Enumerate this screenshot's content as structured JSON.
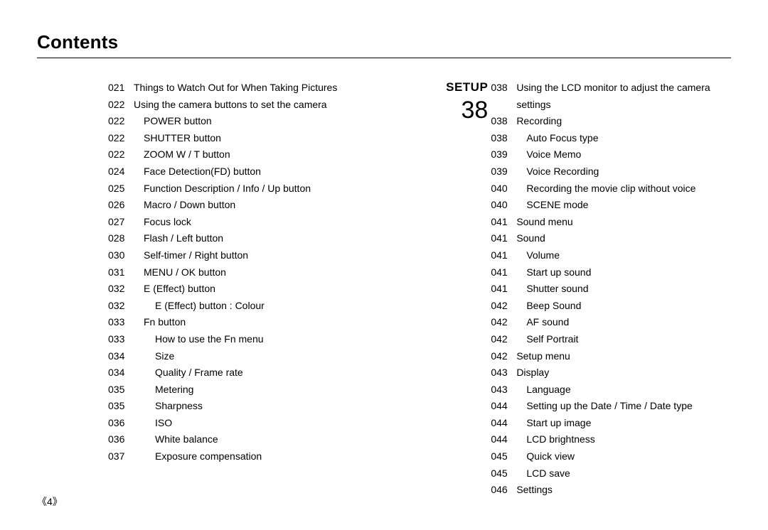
{
  "title": "Contents",
  "page_number": "4",
  "left_column": [
    {
      "page": "021",
      "text": "Things to Watch Out for When Taking Pictures",
      "indent": 0
    },
    {
      "page": "022",
      "text": "Using the camera buttons to set the camera",
      "indent": 0
    },
    {
      "page": "022",
      "text": "POWER button",
      "indent": 1
    },
    {
      "page": "022",
      "text": "SHUTTER button",
      "indent": 1
    },
    {
      "page": "022",
      "text": "ZOOM W / T button",
      "indent": 1
    },
    {
      "page": "024",
      "text": "Face Detection(FD) button",
      "indent": 1
    },
    {
      "page": "025",
      "text": "Function Description / Info / Up button",
      "indent": 1
    },
    {
      "page": "026",
      "text": "Macro / Down button",
      "indent": 1
    },
    {
      "page": "027",
      "text": "Focus lock",
      "indent": 1
    },
    {
      "page": "028",
      "text": "Flash / Left button",
      "indent": 1
    },
    {
      "page": "030",
      "text": "Self-timer / Right button",
      "indent": 1
    },
    {
      "page": "031",
      "text": "MENU / OK button",
      "indent": 1
    },
    {
      "page": "032",
      "text": "E (Effect) button",
      "indent": 1
    },
    {
      "page": "032",
      "text": "E (Effect) button : Colour",
      "indent": 2
    },
    {
      "page": "033",
      "text": "Fn button",
      "indent": 1
    },
    {
      "page": "033",
      "text": "How to use the Fn menu",
      "indent": 2
    },
    {
      "page": "034",
      "text": "Size",
      "indent": 2
    },
    {
      "page": "034",
      "text": "Quality / Frame rate",
      "indent": 2
    },
    {
      "page": "035",
      "text": "Metering",
      "indent": 2
    },
    {
      "page": "035",
      "text": "Sharpness",
      "indent": 2
    },
    {
      "page": "036",
      "text": "ISO",
      "indent": 2
    },
    {
      "page": "036",
      "text": "White balance",
      "indent": 2
    },
    {
      "page": "037",
      "text": "Exposure compensation",
      "indent": 2
    }
  ],
  "right_section": {
    "label": "SETUP",
    "number": "38",
    "items": [
      {
        "page": "038",
        "text": "Using the LCD monitor to adjust the camera settings",
        "indent": 0
      },
      {
        "page": "038",
        "text": "Recording",
        "indent": 0
      },
      {
        "page": "038",
        "text": "Auto Focus type",
        "indent": 1
      },
      {
        "page": "039",
        "text": "Voice Memo",
        "indent": 1
      },
      {
        "page": "039",
        "text": "Voice Recording",
        "indent": 1
      },
      {
        "page": "040",
        "text": "Recording the movie clip without voice",
        "indent": 1
      },
      {
        "page": "040",
        "text": "SCENE mode",
        "indent": 1
      },
      {
        "page": "041",
        "text": "Sound menu",
        "indent": 0
      },
      {
        "page": "041",
        "text": "Sound",
        "indent": 0
      },
      {
        "page": "041",
        "text": "Volume",
        "indent": 1
      },
      {
        "page": "041",
        "text": "Start up sound",
        "indent": 1
      },
      {
        "page": "041",
        "text": "Shutter sound",
        "indent": 1
      },
      {
        "page": "042",
        "text": "Beep Sound",
        "indent": 1
      },
      {
        "page": "042",
        "text": "AF sound",
        "indent": 1
      },
      {
        "page": "042",
        "text": "Self Portrait",
        "indent": 1
      },
      {
        "page": "042",
        "text": "Setup menu",
        "indent": 0
      },
      {
        "page": "043",
        "text": "Display",
        "indent": 0
      },
      {
        "page": "043",
        "text": "Language",
        "indent": 1
      },
      {
        "page": "044",
        "text": "Setting up the Date / Time / Date type",
        "indent": 1
      },
      {
        "page": "044",
        "text": "Start up image",
        "indent": 1
      },
      {
        "page": "044",
        "text": "LCD brightness",
        "indent": 1
      },
      {
        "page": "045",
        "text": "Quick view",
        "indent": 1
      },
      {
        "page": "045",
        "text": "LCD save",
        "indent": 1
      },
      {
        "page": "046",
        "text": "Settings",
        "indent": 0
      }
    ]
  }
}
